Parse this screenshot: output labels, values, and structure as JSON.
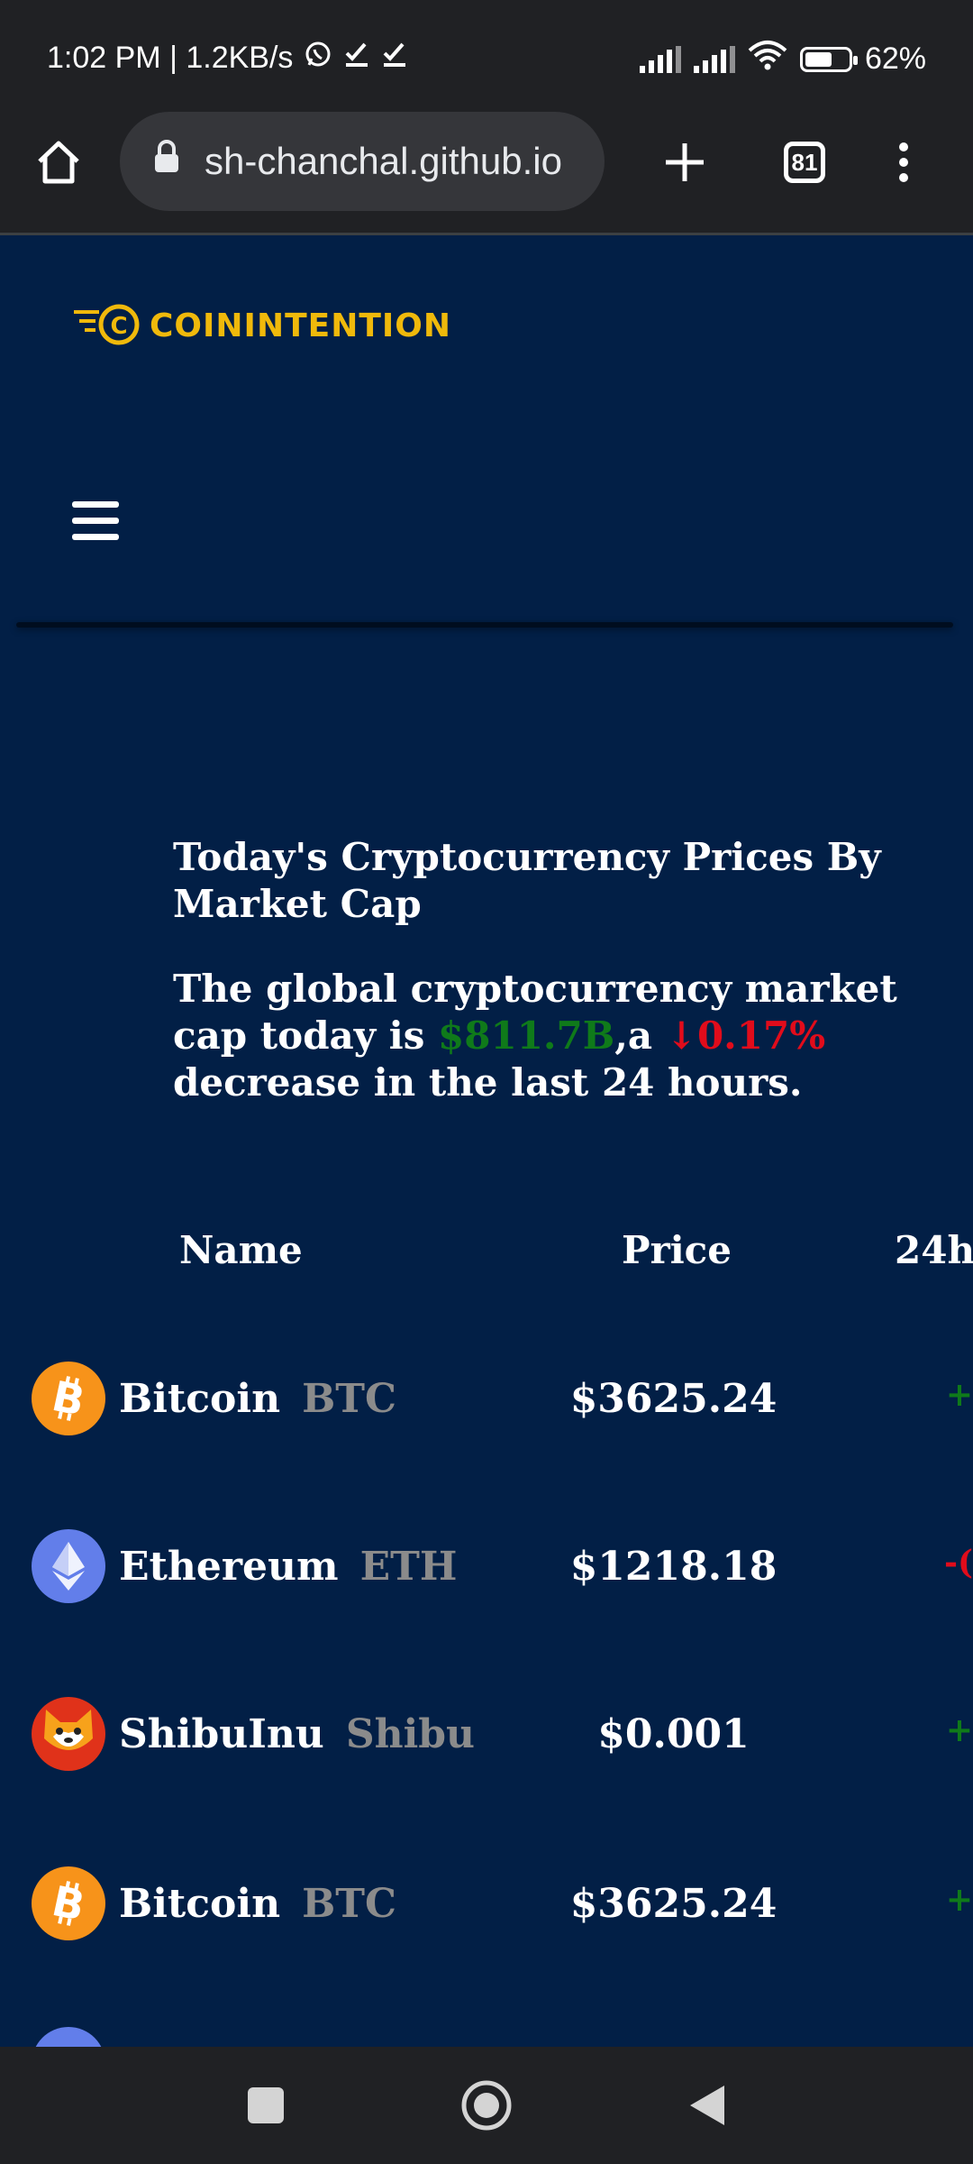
{
  "status_bar": {
    "time_speed": "1:02 PM | 1.2KB/s",
    "battery": "62%",
    "battery_level": 0.62
  },
  "browser": {
    "url": "sh-chanchal.github.io",
    "tab_count": "81"
  },
  "site": {
    "brand": "COININTENTION",
    "hero_title": "Today's Cryptocurrency Prices By Market Cap",
    "hero_text_1": "The global cryptocurrency market cap today is ",
    "market_cap": "$811.7B",
    "hero_text_2": ",a ",
    "change_arrow": "↓",
    "change_pct": "0.17%",
    "hero_text_3": " decrease in the last 24 hours."
  },
  "table": {
    "headers": {
      "name": "Name",
      "price": "Price",
      "change": "24h"
    },
    "rows": [
      {
        "name": "Bitcoin",
        "symbol": "BTC",
        "price": "$3625.24",
        "change": "+",
        "icon": "bitcoin-icon",
        "change_color": "#0f7a1a"
      },
      {
        "name": "Ethereum",
        "symbol": "ETH",
        "price": "$1218.18",
        "change": "-(",
        "icon": "ethereum-icon",
        "change_color": "#e10c1b"
      },
      {
        "name": "ShibuInu",
        "symbol": "Shibu",
        "price": "$0.001",
        "change": "+",
        "icon": "shiba-inu-icon",
        "change_color": "#0f7a1a"
      },
      {
        "name": "Bitcoin",
        "symbol": "BTC",
        "price": "$3625.24",
        "change": "+",
        "icon": "bitcoin-icon",
        "change_color": "#0f7a1a"
      }
    ]
  },
  "colors": {
    "background": "#021f46",
    "brand": "#f0b90b",
    "positive": "#0f7a1a",
    "negative": "#e10c1b"
  }
}
